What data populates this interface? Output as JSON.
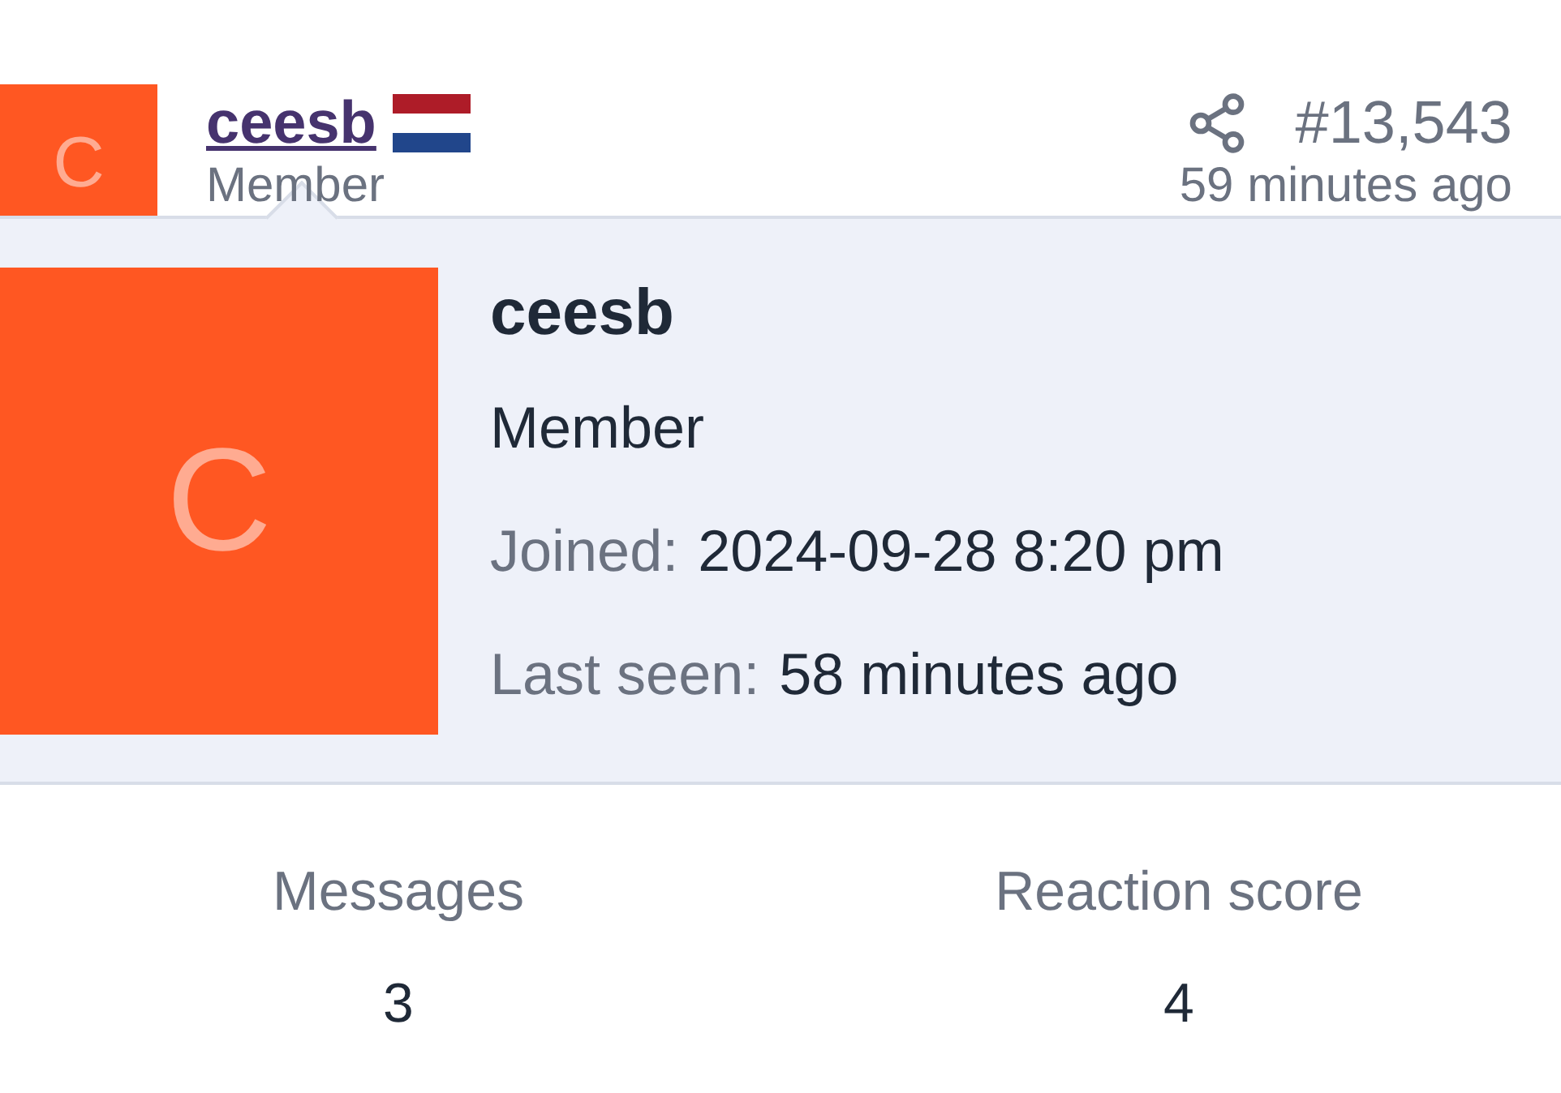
{
  "post": {
    "avatar_letter": "C",
    "username": "ceesb",
    "user_title": "Member",
    "post_number": "#13,543",
    "time": "59 minutes ago"
  },
  "popup": {
    "avatar_letter": "C",
    "username": "ceesb",
    "user_title": "Member",
    "details": [
      {
        "label": "Joined:",
        "value": "2024-09-28 8:20 pm"
      },
      {
        "label": "Last seen:",
        "value": "58 minutes ago"
      }
    ]
  },
  "stats": [
    {
      "label": "Messages",
      "value": "3"
    },
    {
      "label": "Reaction score",
      "value": "4"
    }
  ]
}
